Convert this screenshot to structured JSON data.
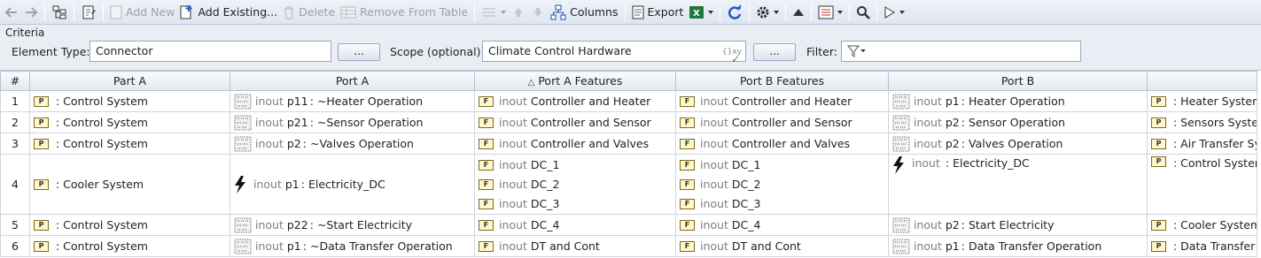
{
  "toolbar": {
    "add_new": "Add New",
    "add_existing": "Add Existing...",
    "delete": "Delete",
    "remove_from_table": "Remove From Table",
    "columns": "Columns",
    "export": "Export"
  },
  "criteria": {
    "title": "Criteria",
    "element_type_label": "Element Type:",
    "element_type_value": "Connector",
    "browse_label": "...",
    "scope_label": "Scope (optional):",
    "scope_value": "Climate Control Hardware",
    "scope_badge": "{}xy",
    "filter_label": "Filter:"
  },
  "table": {
    "headers": [
      "#",
      "Part A",
      "Port A",
      "Port A Features",
      "Port B Features",
      "Port B",
      ""
    ],
    "sort_indicator": "△",
    "rows": [
      {
        "num": "1",
        "part_a": ": Control System",
        "port_a": {
          "kw": "inout",
          "name": "p11",
          "type": "~Heater Operation",
          "bolt": false
        },
        "a_features": [
          {
            "kw": "inout",
            "name": "Controller and Heater"
          }
        ],
        "b_features": [
          {
            "kw": "inout",
            "name": "Controller and Heater"
          }
        ],
        "port_b": {
          "kw": "inout",
          "name": "p1",
          "type": "Heater Operation",
          "bolt": false
        },
        "part_b": ": Heater System"
      },
      {
        "num": "2",
        "part_a": ": Control System",
        "port_a": {
          "kw": "inout",
          "name": "p21",
          "type": "~Sensor Operation",
          "bolt": false
        },
        "a_features": [
          {
            "kw": "inout",
            "name": "Controller and Sensor"
          }
        ],
        "b_features": [
          {
            "kw": "inout",
            "name": "Controller and Sensor"
          }
        ],
        "port_b": {
          "kw": "inout",
          "name": "p2",
          "type": "Sensor Operation",
          "bolt": false
        },
        "part_b": ": Sensors System"
      },
      {
        "num": "3",
        "part_a": ": Control System",
        "port_a": {
          "kw": "inout",
          "name": "p2",
          "type": "~Valves Operation",
          "bolt": false
        },
        "a_features": [
          {
            "kw": "inout",
            "name": "Controller and Valves"
          }
        ],
        "b_features": [
          {
            "kw": "inout",
            "name": "Controller and Valves"
          }
        ],
        "port_b": {
          "kw": "inout",
          "name": "p2",
          "type": "Valves Operation",
          "bolt": false
        },
        "part_b": ": Air Transfer System"
      },
      {
        "num": "4",
        "part_a": ": Cooler System",
        "port_a": {
          "kw": "inout",
          "name": "p1",
          "type": "Electricity_DC",
          "bolt": true
        },
        "a_features": [
          {
            "kw": "inout",
            "name": "DC_1"
          },
          {
            "kw": "inout",
            "name": "DC_2"
          },
          {
            "kw": "inout",
            "name": "DC_3"
          }
        ],
        "b_features": [
          {
            "kw": "inout",
            "name": "DC_1"
          },
          {
            "kw": "inout",
            "name": "DC_2"
          },
          {
            "kw": "inout",
            "name": "DC_3"
          }
        ],
        "port_b": {
          "kw": "inout",
          "name": "",
          "type": "Electricity_DC",
          "bolt": true
        },
        "part_b": ": Control System"
      },
      {
        "num": "5",
        "part_a": ": Control System",
        "port_a": {
          "kw": "inout",
          "name": "p22",
          "type": "~Start Electricity",
          "bolt": false
        },
        "a_features": [
          {
            "kw": "inout",
            "name": "DC_4"
          }
        ],
        "b_features": [
          {
            "kw": "inout",
            "name": "DC_4"
          }
        ],
        "port_b": {
          "kw": "inout",
          "name": "p2",
          "type": "Start Electricity",
          "bolt": false
        },
        "part_b": ": Cooler System"
      },
      {
        "num": "6",
        "part_a": ": Control System",
        "port_a": {
          "kw": "inout",
          "name": "p1",
          "type": "~Data Transfer Operation",
          "bolt": false
        },
        "a_features": [
          {
            "kw": "inout",
            "name": "DT and Cont"
          }
        ],
        "b_features": [
          {
            "kw": "inout",
            "name": "DT and Cont"
          }
        ],
        "port_b": {
          "kw": "inout",
          "name": "p1",
          "type": "Data Transfer Operation",
          "bolt": false
        },
        "part_b": ": Data Transfer System"
      }
    ]
  }
}
